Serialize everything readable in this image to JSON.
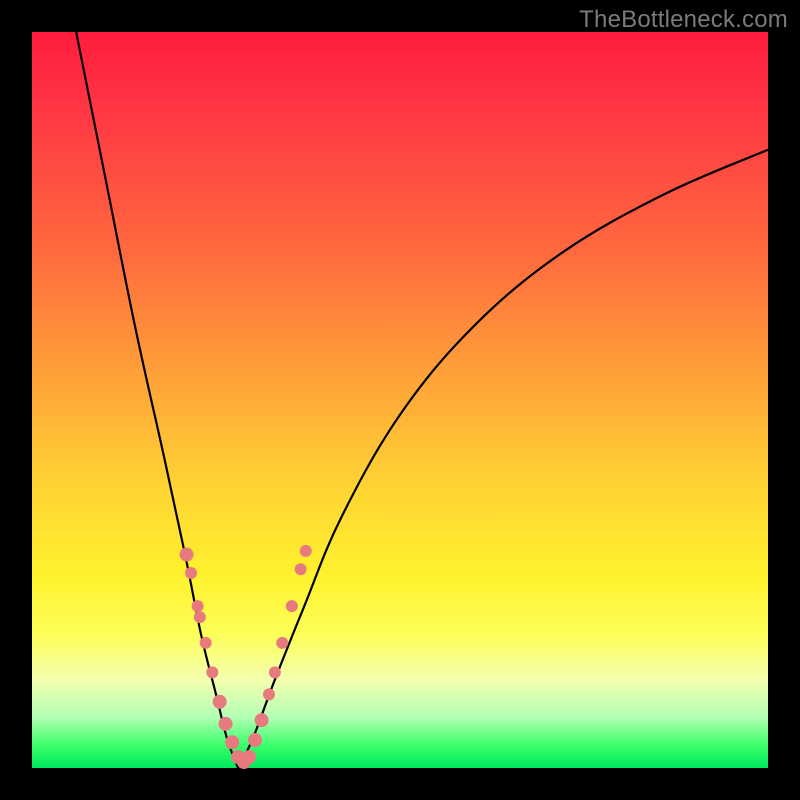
{
  "watermark": "TheBottleneck.com",
  "colors": {
    "dot": "#e77a7e",
    "curve": "#000000",
    "frame": "#000000"
  },
  "chart_data": {
    "type": "line",
    "title": "",
    "xlabel": "",
    "ylabel": "",
    "xlim": [
      0,
      100
    ],
    "ylim": [
      0,
      100
    ],
    "notes": "V-shaped curve on a red-to-green vertical gradient background. No axis ticks or numeric labels are visible; values are pixel-normalized 0–100 estimates. The curve dips to a minimum near x≈28, reaching y≈0 (green region). Salmon-colored dots cluster along the lower portion of both arms of the V.",
    "series": [
      {
        "name": "curve-left",
        "x": [
          6,
          10,
          14,
          18,
          21,
          23,
          25,
          26.5,
          28
        ],
        "y": [
          100,
          80,
          60,
          42,
          28,
          18,
          10,
          4,
          0
        ]
      },
      {
        "name": "curve-right",
        "x": [
          28,
          30,
          33,
          37,
          42,
          50,
          60,
          72,
          86,
          100
        ],
        "y": [
          0,
          4,
          12,
          22,
          34,
          48,
          60,
          70,
          78,
          84
        ]
      }
    ],
    "points": [
      {
        "name": "dots-left",
        "x": [
          21.0,
          21.6,
          22.5,
          22.8,
          23.6,
          24.5,
          25.5,
          26.3,
          27.2,
          28.0,
          28.8
        ],
        "y": [
          29.0,
          26.5,
          22.0,
          20.5,
          17.0,
          13.0,
          9.0,
          6.0,
          3.5,
          1.5,
          0.8
        ],
        "r": [
          7,
          6,
          6,
          6,
          6,
          6,
          7,
          7,
          7,
          7,
          7
        ]
      },
      {
        "name": "dots-right",
        "x": [
          29.5,
          30.3,
          31.2,
          32.2,
          33.0,
          34.0,
          35.3,
          36.5,
          37.2
        ],
        "y": [
          1.5,
          3.8,
          6.5,
          10.0,
          13.0,
          17.0,
          22.0,
          27.0,
          29.5
        ],
        "r": [
          7,
          7,
          7,
          6,
          6,
          6,
          6,
          6,
          6
        ]
      }
    ]
  }
}
